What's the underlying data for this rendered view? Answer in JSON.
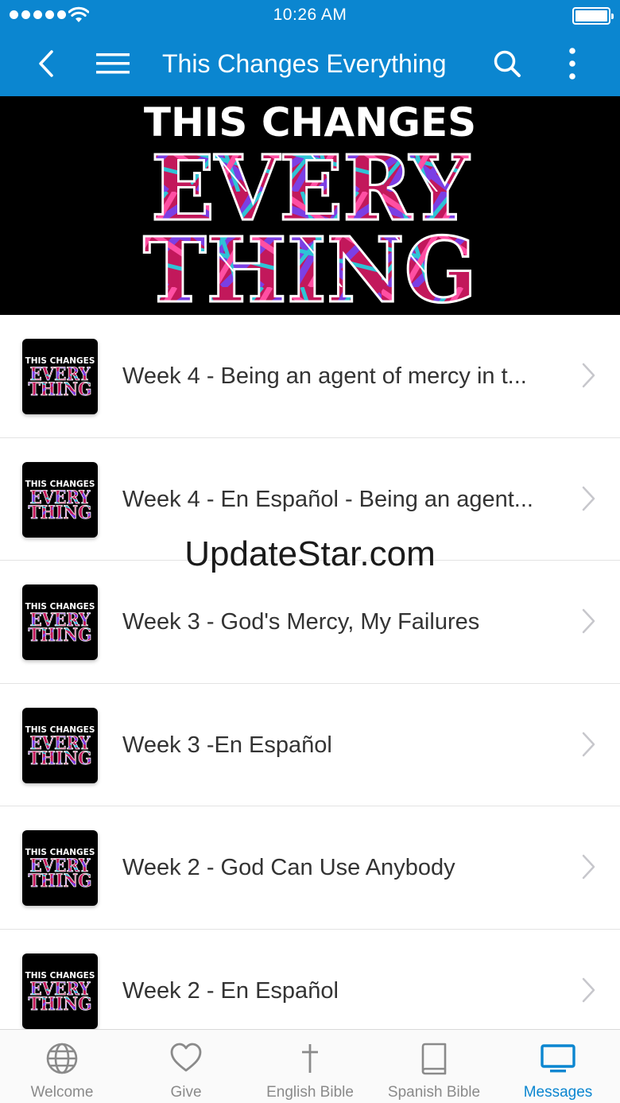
{
  "status_bar": {
    "time": "10:26 AM"
  },
  "nav": {
    "title": "This Changes Everything"
  },
  "banner": {
    "line1": "THIS CHANGES",
    "line2": "EVERY",
    "line3": "THING"
  },
  "thumbnail": {
    "line1": "THIS CHANGES",
    "line2": "EVERY",
    "line3": "THING"
  },
  "messages": [
    {
      "title": "Week 4 - Being an agent of mercy in t..."
    },
    {
      "title": "Week 4 - En Español - Being an agent..."
    },
    {
      "title": "Week 3 - God's Mercy, My Failures"
    },
    {
      "title": "Week 3 -En Español"
    },
    {
      "title": "Week 2 - God Can Use Anybody"
    },
    {
      "title": "Week 2 - En Español"
    }
  ],
  "watermark": "UpdateStar.com",
  "tabs": [
    {
      "label": "Welcome",
      "icon": "globe-icon"
    },
    {
      "label": "Give",
      "icon": "heart-icon"
    },
    {
      "label": "English Bible",
      "icon": "cross-icon"
    },
    {
      "label": "Spanish Bible",
      "icon": "book-icon"
    },
    {
      "label": "Messages",
      "icon": "tv-icon",
      "active": true
    }
  ],
  "colors": {
    "primary": "#0b86d0",
    "tab_inactive": "#8a8a8a",
    "banner_bg": "#000000"
  }
}
